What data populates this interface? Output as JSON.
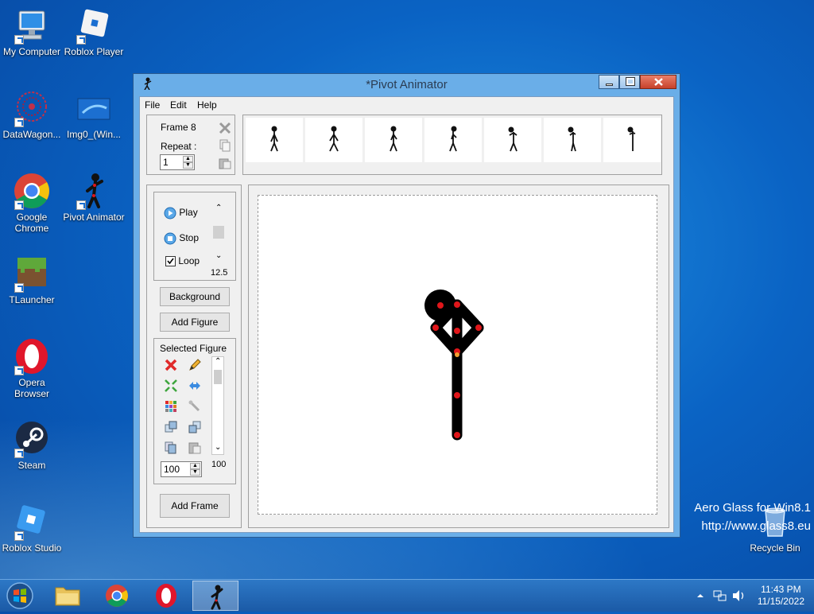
{
  "desktop": {
    "icons": [
      {
        "label": "My Computer"
      },
      {
        "label": "Roblox Player"
      },
      {
        "label": "DataWagon..."
      },
      {
        "label": "Img0_(Win..."
      },
      {
        "label": "Google Chrome"
      },
      {
        "label": "Pivot Animator"
      },
      {
        "label": "TLauncher"
      },
      {
        "label": "Opera Browser"
      },
      {
        "label": "Steam"
      },
      {
        "label": "Roblox Studio"
      },
      {
        "label": "Recycle Bin"
      }
    ],
    "watermark_line1": "Aero Glass for Win8.1",
    "watermark_line2": "http://www.glass8.eu"
  },
  "window": {
    "title": "*Pivot Animator",
    "menu": [
      "File",
      "Edit",
      "Help"
    ],
    "frame_panel": {
      "frame_label": "Frame 8",
      "repeat_label": "Repeat :",
      "repeat_value": "1"
    },
    "playback": {
      "play": "Play",
      "stop": "Stop",
      "loop": "Loop",
      "loop_checked": true,
      "speed": "12.5"
    },
    "buttons": {
      "background": "Background",
      "add_figure": "Add Figure",
      "add_frame": "Add Frame"
    },
    "selected_figure": {
      "label": "Selected Figure",
      "size_value": "100",
      "size_readout": "100"
    }
  },
  "taskbar": {
    "time": "11:43 PM",
    "date": "11/15/2022"
  },
  "colors": {
    "accent": "#1a6fd1",
    "joint": "#e0161a",
    "delete": "#e02a2a"
  }
}
